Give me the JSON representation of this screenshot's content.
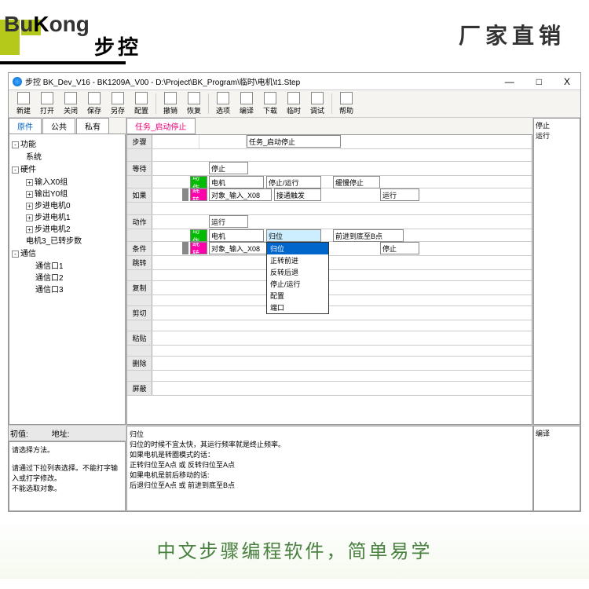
{
  "header": {
    "slogan": "厂家直销",
    "logo_en": "BuKong",
    "logo_cn": "步控"
  },
  "window": {
    "title": "步控  BK_Dev_V16   -  BK1209A_V00  -  D:\\Project\\BK_Program\\临时\\电机\\t1.Step",
    "min": "—",
    "max": "□",
    "close": "X"
  },
  "toolbar": [
    "新建",
    "打开",
    "关闭",
    "保存",
    "另存",
    "配置",
    "撤销",
    "恢复",
    "选项",
    "编译",
    "下载",
    "临时",
    "调试",
    "帮助"
  ],
  "left_tabs": [
    "原件",
    "公共",
    "私有"
  ],
  "tree": {
    "root1": "功能",
    "root1a": "系统",
    "root2": "硬件",
    "hw": [
      "输入X0组",
      "输出Y0组",
      "步进电机0",
      "步进电机1",
      "步进电机2",
      "电机3_已转步数"
    ],
    "root3": "通信",
    "comm": [
      "通信口1",
      "通信口2",
      "通信口3"
    ]
  },
  "center_tab": "任务_启动停止",
  "row_labels": [
    "步骤",
    "等待",
    "如果",
    "动作",
    "条件",
    "跳转",
    "复制",
    "剪切",
    "粘贴",
    "删除",
    "屏蔽"
  ],
  "grid": {
    "task_header": "任务_启动停止",
    "stop": "停止",
    "run": "运行",
    "action": "动作",
    "jump": "跳转",
    "motor": "电机",
    "stop_run": "停止/运行",
    "slow_stop": "缓慢停止",
    "obj_x08": "对象_输入_X08",
    "trig": "接通触发",
    "combo_val": "归位",
    "forward_b": "前进到底至B点",
    "dropdown": [
      "归位",
      "正转前进",
      "反转后退",
      "停止/运行",
      "配置",
      "端口"
    ]
  },
  "right_panel": [
    "停止",
    "运行"
  ],
  "bottom": {
    "labels": [
      "初值:",
      "地址:"
    ],
    "left_text": "请选择方法。\n\n请通过下拉列表选择。不能打字输入或打字修改。\n不能选取对象。",
    "center_text": "归位\n归位的时候不宜太快，其运行频率就是终止频率。\n如果电机是转圈模式的话：\n正转归位至A点 或 反转归位至A点\n如果电机是前后移动的话:\n后退归位至A点 或 前进到底至B点",
    "right_label": "编译"
  },
  "footer": "中文步骤编程软件，简单易学"
}
